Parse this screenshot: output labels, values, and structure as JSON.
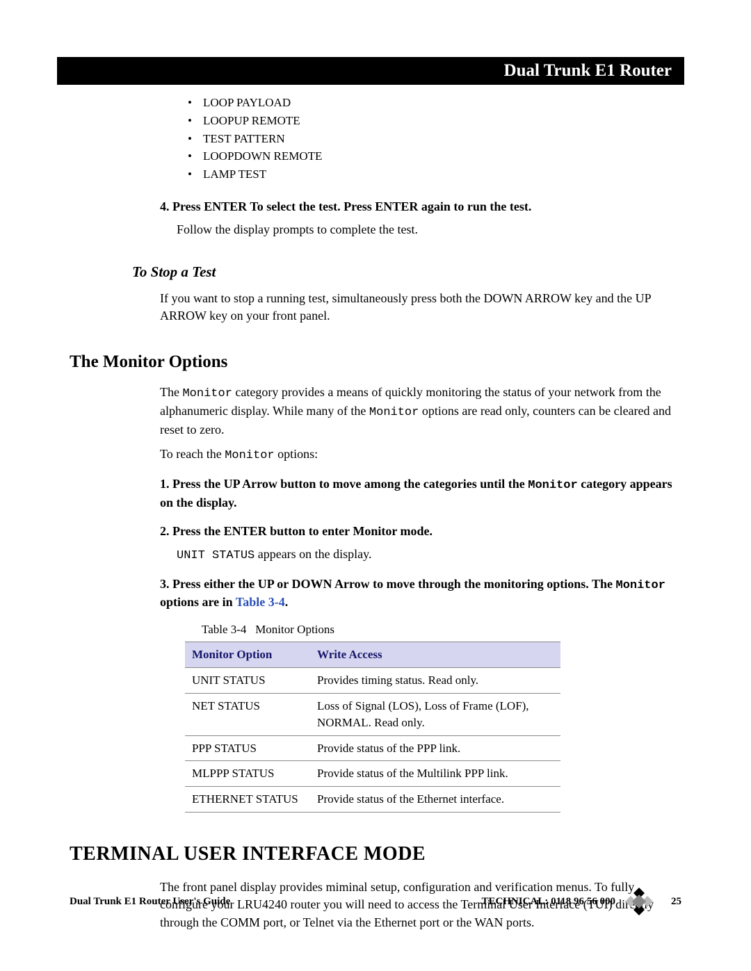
{
  "header": {
    "title": "Dual Trunk E1 Router"
  },
  "bullets": {
    "b1": "LOOP PAYLOAD",
    "b2": "LOOPUP REMOTE",
    "b3": "TEST PATTERN",
    "b4": "LOOPDOWN REMOTE",
    "b5": "LAMP TEST"
  },
  "step4": {
    "title": "4.  Press ENTER To select the test. Press ENTER again to run the test.",
    "body": "Follow the display prompts to complete the test."
  },
  "stop": {
    "heading": "To Stop a Test",
    "body": "If you want to stop a running test, simultaneously press both the DOWN ARROW key and the UP ARROW key on your front panel."
  },
  "monitor": {
    "heading": "The Monitor Options",
    "p1a": "The ",
    "p1m": "Monitor",
    "p1b": " category provides a means of quickly monitoring the status of your network from the alphanumeric display. While many of the ",
    "p1c": " options are read only, counters can be cleared and reset to zero.",
    "p2a": "To reach the ",
    "p2b": " options:",
    "s1a": "1.  Press the UP Arrow button to move among the categories until the ",
    "s1m": "Monitor",
    "s1b": " category appears on the display.",
    "s2": "2.  Press the ENTER button to enter Monitor mode.",
    "s2body_a": "UNIT STATUS",
    "s2body_b": " appears on the display.",
    "s3a": "3.  Press either the UP or DOWN Arrow to move through the monitoring options. The ",
    "s3m": "Monitor",
    "s3b": " options are in ",
    "s3link": "Table 3-4",
    "s3c": "."
  },
  "table": {
    "caption_a": "Table 3-4",
    "caption_b": "Monitor Options",
    "th1": "Monitor Option",
    "th2": "Write Access",
    "rows": {
      "r0": {
        "c1": "UNIT STATUS",
        "c2": "Provides timing status. Read only."
      },
      "r1": {
        "c1": "NET STATUS",
        "c2": "Loss of Signal (LOS), Loss of Frame (LOF), NORMAL. Read only."
      },
      "r2": {
        "c1": "PPP STATUS",
        "c2": "Provide status of the PPP link."
      },
      "r3": {
        "c1": "MLPPP STATUS",
        "c2": "Provide status of the Multilink PPP link."
      },
      "r4": {
        "c1": "ETHERNET STATUS",
        "c2": "Provide status of the Ethernet interface."
      }
    }
  },
  "tui": {
    "heading": "TERMINAL USER INTERFACE MODE",
    "body": "The front panel display provides miminal setup, configuration and verification menus. To fully configure your LRU4240 router you will need to access the Terminal User Interface (TUI) directly through the COMM port, or Telnet via the Ethernet port or the WAN ports."
  },
  "footer": {
    "guide": "Dual Trunk E1 Router User's Guide",
    "tech": "TECHNICAL:  0118 96 56 000",
    "page": "25"
  }
}
